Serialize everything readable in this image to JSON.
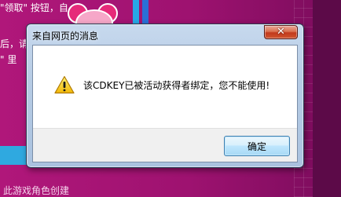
{
  "background": {
    "lines": [
      "\"领取\" 按钮，自",
      "后，请",
      "\" 里",
      "此游戏角色创建"
    ]
  },
  "dialog": {
    "title": "来自网页的消息",
    "close_symbol": "✕",
    "message": "该CDKEY已被活动获得者绑定，您不能使用!",
    "ok_label": "确定",
    "icon": "warning-icon"
  },
  "colors": {
    "page_bg": "#a0146e",
    "accent_cyan": "#27a8e6",
    "close_red": "#c2391c",
    "button_border": "#3c7fb1"
  }
}
